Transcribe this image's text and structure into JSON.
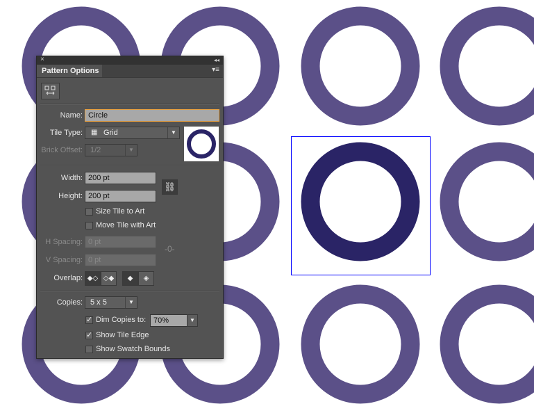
{
  "colors": {
    "copy_ring": "#5b5088",
    "tile_ring": "#2a2466",
    "tile_bounds": "#0000ff"
  },
  "panel": {
    "close_glyph": "×",
    "collapse_glyph": "◂◂",
    "menu_glyph": "▾≡",
    "tab": "Pattern Options",
    "name_label": "Name:",
    "name_value": "Circle",
    "tile_type_label": "Tile Type:",
    "tile_type_value": "Grid",
    "brick_offset_label": "Brick Offset:",
    "brick_offset_value": "1/2",
    "width_label": "Width:",
    "width_value": "200 pt",
    "height_label": "Height:",
    "height_value": "200 pt",
    "size_tile_label": "Size Tile to Art",
    "size_tile_checked": false,
    "move_tile_label": "Move Tile with Art",
    "move_tile_checked": false,
    "h_spacing_label": "H Spacing:",
    "h_spacing_value": "0 pt",
    "v_spacing_label": "V Spacing:",
    "v_spacing_value": "0 pt",
    "overlap_label": "Overlap:",
    "copies_label": "Copies:",
    "copies_value": "5 x 5",
    "dim_label": "Dim Copies to:",
    "dim_checked": true,
    "dim_value": "70%",
    "show_tile_edge_label": "Show Tile Edge",
    "show_tile_edge_checked": true,
    "show_swatch_bounds_label": "Show Swatch Bounds",
    "show_swatch_bounds_checked": false,
    "check_glyph": "✓",
    "arrow_glyph": "▼"
  }
}
